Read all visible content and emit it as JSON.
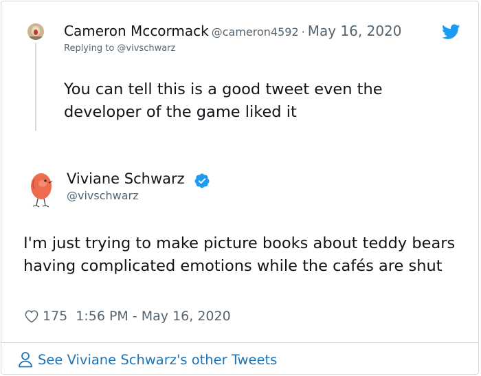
{
  "reply": {
    "name": "Cameron Mccormack",
    "handle": "@cameron4592",
    "separator": "·",
    "date": "May 16, 2020",
    "replying_to": "Replying to @vivschwarz",
    "text": "You can tell this is a good tweet even the developer of the game liked it"
  },
  "tweet": {
    "name": "Viviane Schwarz",
    "handle": "@vivschwarz",
    "text": "I'm just trying to make picture books about teddy bears having complicated emotions while the cafés are shut",
    "likes": "175",
    "timestamp": "1:56 PM - May 16, 2020"
  },
  "footer": {
    "link_label": "See Viviane Schwarz's other Tweets"
  },
  "icons": {
    "brand": "twitter-bird-icon",
    "verified": "verified-badge-icon",
    "like": "heart-icon",
    "profile": "person-icon"
  },
  "colors": {
    "twitter_blue": "#1d9bf0",
    "link": "#1b73b8",
    "text_primary": "#0f1419",
    "text_secondary": "#536471",
    "border": "#cfd9de"
  }
}
